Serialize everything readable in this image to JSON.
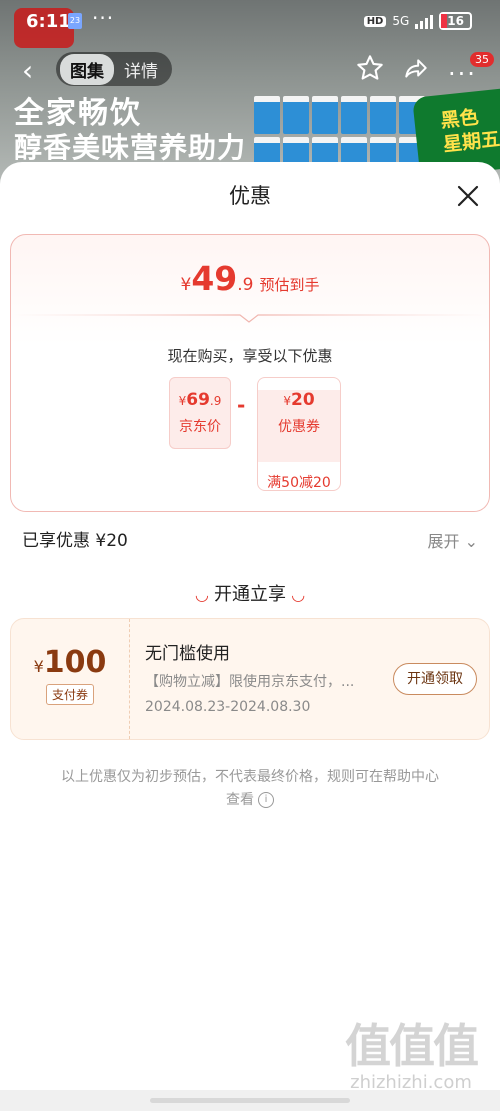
{
  "status": {
    "time": "6:11",
    "calendar_badge": "23",
    "network": "5G",
    "battery": "16"
  },
  "product_header": {
    "tabs": [
      "图集",
      "详情"
    ],
    "notification_count": "35",
    "ad_line1": "全家畅饮",
    "ad_line2": "醇香美味营养助力",
    "promo_line1": "黑色",
    "promo_line2": "星期五"
  },
  "sheet": {
    "title": "优惠",
    "estimate": {
      "currency": "¥",
      "integer": "49",
      "decimal": ".9",
      "label": "预估到手"
    },
    "subtitle": "现在购买，享受以下优惠",
    "jd_price": {
      "currency": "¥",
      "integer": "69",
      "decimal": ".9",
      "label": "京东价"
    },
    "minus": "-",
    "coupon_discount": {
      "currency": "¥",
      "value": "20",
      "label": "优惠券",
      "condition": "满50减20"
    },
    "saved": "已享优惠 ¥20",
    "expand": "展开",
    "open_section_title": "开通立享",
    "pay_coupon": {
      "currency": "¥",
      "amount": "100",
      "type": "支付券",
      "title": "无门槛使用",
      "desc": "【购物立减】限使用京东支付，...",
      "date": "2024.08.23-2024.08.30",
      "button": "开通领取"
    },
    "disclaimer": "以上优惠仅为初步预估，不代表最终价格，规则可在帮助中心查看"
  },
  "watermark": {
    "text": "zhizhizhi.com"
  },
  "colors": {
    "accent_red": "#e53a2f",
    "coupon_brown": "#8a3a10"
  }
}
